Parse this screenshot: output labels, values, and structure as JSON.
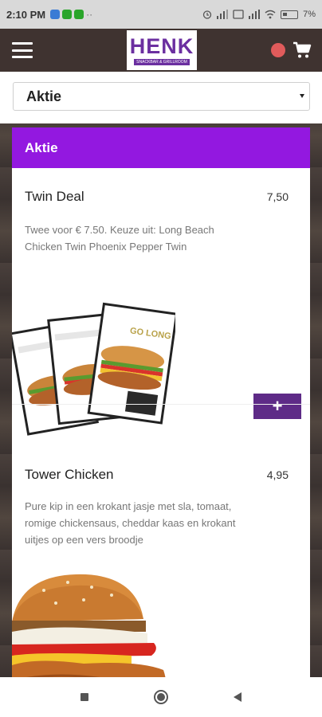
{
  "status_bar": {
    "time": "2:10 PM",
    "battery_text": "7%"
  },
  "app_bar": {
    "logo_text": "HENK",
    "logo_tagline": "SNACKBAR & GRILLROOM"
  },
  "category_select": {
    "selected": "Aktie"
  },
  "category": {
    "title": "Aktie"
  },
  "items": [
    {
      "name": "Twin Deal",
      "price": "7,50",
      "description": "Twee voor € 7.50. Keuze uit: Long Beach Chicken Twin Phoenix Pepper Twin",
      "add_label": "+",
      "image_text": "GO LONG"
    },
    {
      "name": "Tower Chicken",
      "price": "4,95",
      "description": "Pure kip in een krokant jasje met sla, tomaat, romige chickensaus, cheddar kaas en krokant uitjes op een vers broodje"
    }
  ],
  "colors": {
    "accent": "#9318e0",
    "add_button": "#5e2b87",
    "app_bar": "#3f3330"
  }
}
